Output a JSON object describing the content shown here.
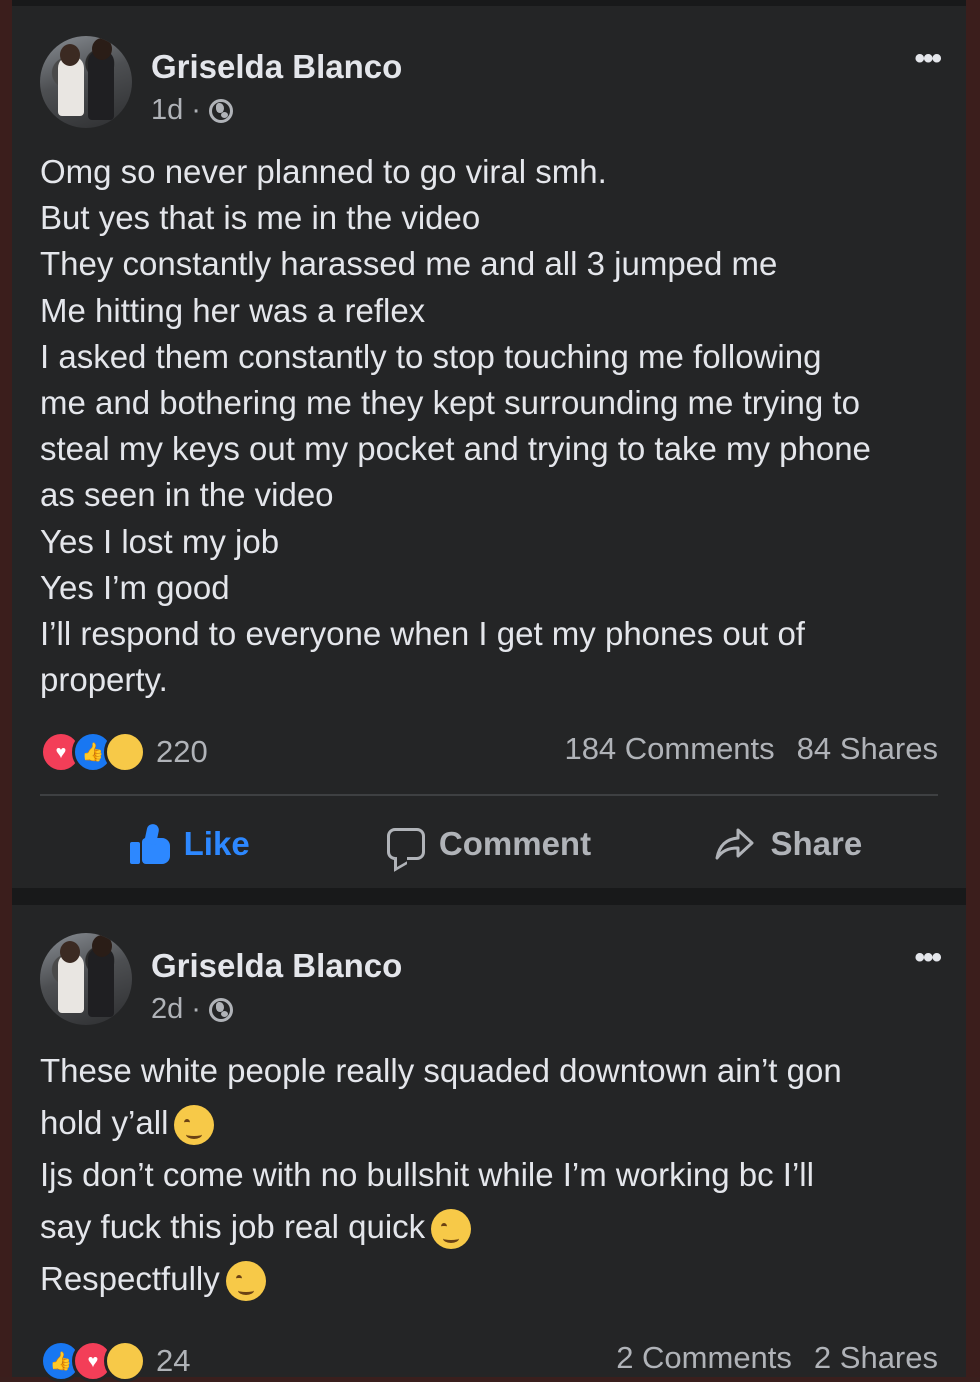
{
  "posts": [
    {
      "author": "Griselda Blanco",
      "time": "1d",
      "dot": "·",
      "more": "•••",
      "lines": [
        "Omg so never planned to go viral smh.",
        "But yes that is me in the video",
        "They constantly harassed me and all 3 jumped me",
        "Me hitting her was a reflex",
        "I asked them constantly to stop touching me following",
        "me and bothering me they kept surrounding me trying to",
        "steal my keys out my pocket and trying to take my phone",
        "as seen in the video",
        "Yes I lost my job",
        "Yes I’m good",
        "I’ll respond to everyone when I get my phones out of",
        "property."
      ],
      "reaction_icons": [
        "love-icon",
        "like-icon",
        "care-icon"
      ],
      "reaction_count": "220",
      "comments": "184 Comments",
      "shares": "84 Shares",
      "actions": {
        "like": "Like",
        "comment": "Comment",
        "share": "Share"
      }
    },
    {
      "author": "Griselda Blanco",
      "time": "2d",
      "dot": "·",
      "more": "•••",
      "lines": [
        "These white people really squaded downtown ain’t gon",
        "hold y’all",
        "Ijs don’t come with no bullshit while I’m working bc I’ll",
        "say fuck this job real quick",
        "Respectfully"
      ],
      "line_emoji_icons": [
        "woozy-face-icon",
        "relieved-face-icon",
        "kissing-face-icon"
      ],
      "reaction_icons": [
        "like-icon",
        "love-icon",
        "haha-icon"
      ],
      "reaction_count": "24",
      "comments": "2 Comments",
      "shares": "2 Shares"
    }
  ],
  "colors": {
    "card": "#242526",
    "text": "#e4e6eb",
    "muted": "#b0b3b8",
    "like_blue": "#2d88ff",
    "love_red": "#f33e58"
  }
}
